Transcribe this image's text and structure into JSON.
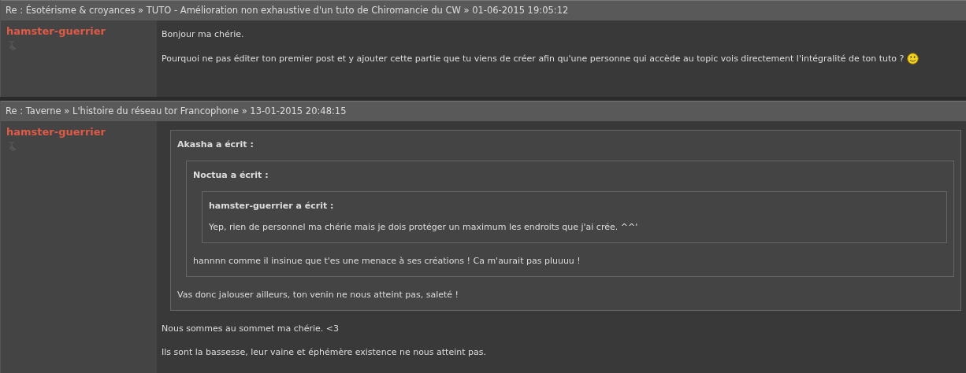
{
  "posts": [
    {
      "header": "Re : Ésotérisme & croyances » TUTO - Amélioration non exhaustive d'un tuto de Chiromancie du CW » 01-06-2015 19:05:12",
      "author": "hamster-guerrier",
      "body": [
        {
          "kind": "paragraph",
          "text": "Bonjour ma chérie."
        },
        {
          "kind": "paragraph",
          "text": "Pourquoi ne pas éditer ton premier post et y ajouter cette partie que tu viens de créer afin qu'une personne qui accède au topic vois directement l'intégralité de ton tuto ?",
          "emoticon": true
        }
      ]
    },
    {
      "header": "Re : Taverne » L'histoire du réseau tor Francophone » 13-01-2015 20:48:15",
      "author": "hamster-guerrier",
      "body": [
        {
          "kind": "quote",
          "author": "Akasha a écrit :",
          "body": [
            {
              "kind": "quote",
              "author": "Noctua a écrit :",
              "body": [
                {
                  "kind": "quote",
                  "author": "hamster-guerrier a écrit :",
                  "body": [
                    {
                      "kind": "paragraph",
                      "text": "Yep, rien de personnel ma chérie mais je dois protéger un maximum les endroits que j'ai crée. ^^'"
                    }
                  ]
                },
                {
                  "kind": "paragraph",
                  "text": "hannnn comme il insinue que t'es une menace à ses créations ! Ca m'aurait pas pluuuu !"
                }
              ]
            },
            {
              "kind": "paragraph",
              "text": "Vas donc jalouser ailleurs, ton venin ne nous atteint pas, saleté !"
            }
          ]
        },
        {
          "kind": "paragraph",
          "text": "Nous sommes au sommet ma chérie. <3"
        },
        {
          "kind": "paragraph",
          "text": "Ils sont la bassesse, leur vaine et éphémère existence ne nous atteint pas."
        }
      ]
    }
  ]
}
